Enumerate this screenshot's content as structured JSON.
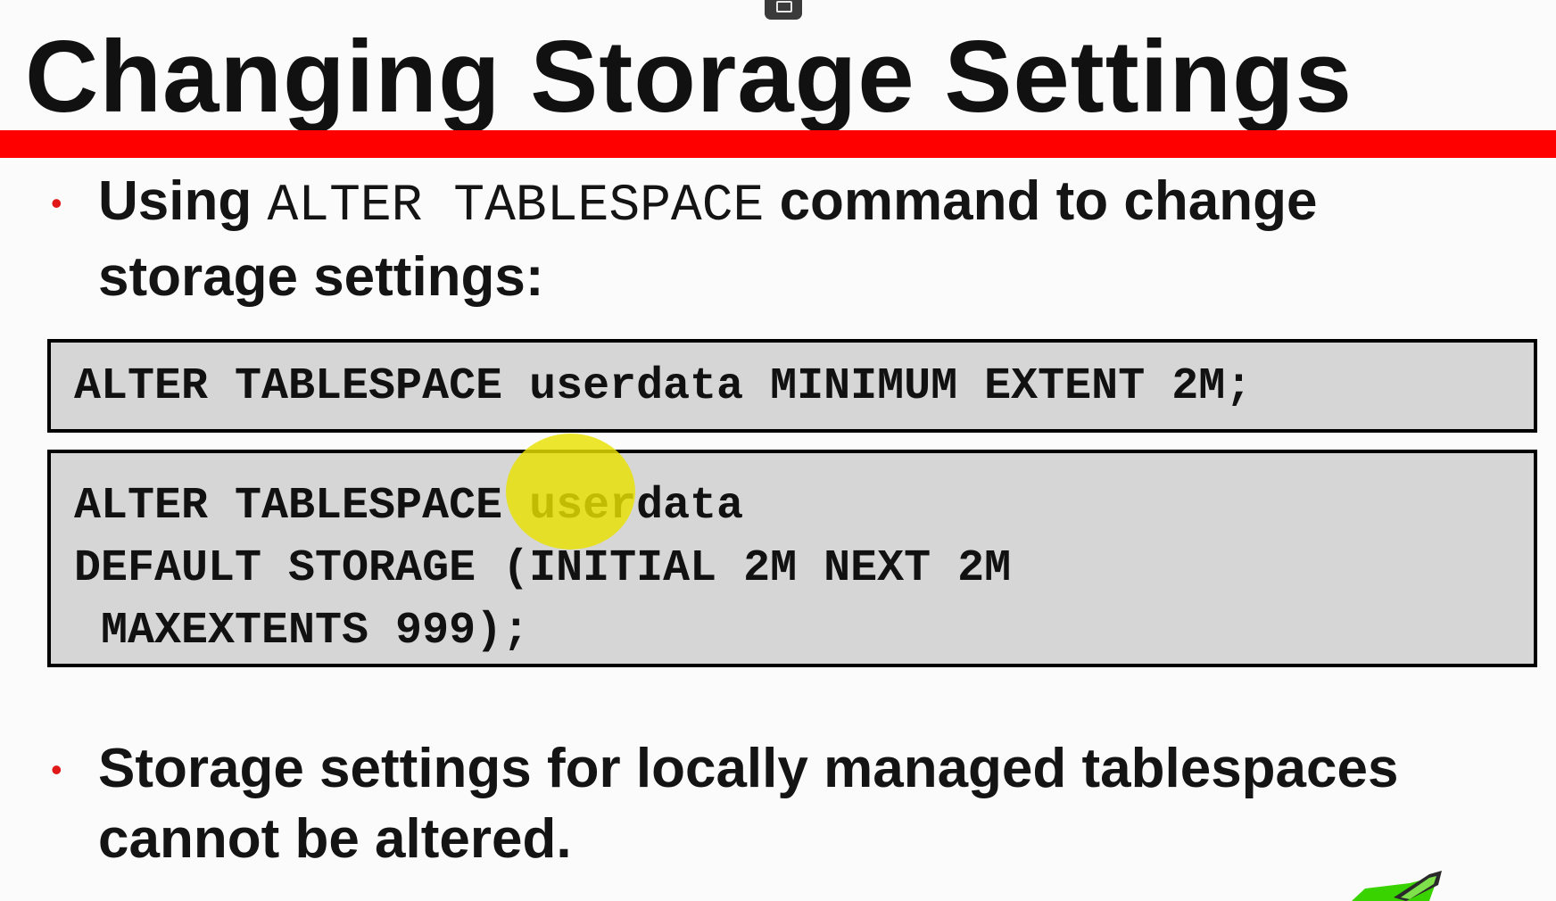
{
  "slide": {
    "title": "Changing Storage Settings",
    "bullets": [
      {
        "prefix": "Using ",
        "code": "ALTER TABLESPACE",
        "suffix": " command to change",
        "line2": "storage settings:"
      },
      {
        "line1": "Storage settings for locally managed tablespaces",
        "line2": "cannot be altered."
      }
    ],
    "code_block_1": "ALTER TABLESPACE userdata MINIMUM EXTENT 2M;",
    "code_block_2": [
      "ALTER TABLESPACE userdata",
      "DEFAULT STORAGE (INITIAL 2M NEXT 2M",
      " MAXEXTENTS 999);"
    ],
    "bullet_glyph": "•"
  },
  "colors": {
    "accent_rule": "#ff0000",
    "bullet": "#e01818",
    "code_background": "#d6d6d6",
    "cursor_highlight": "#e8e200"
  },
  "icons": {
    "top_handle": "window-restore-icon",
    "corner": "rocket-icon"
  }
}
